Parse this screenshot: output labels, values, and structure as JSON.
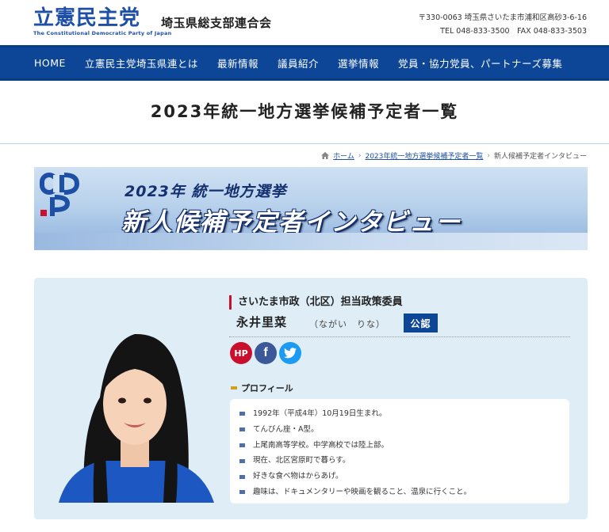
{
  "header": {
    "logo_main": "立憲民主党",
    "logo_sub": "The Constitutional Democratic Party of Japan",
    "branch": "埼玉県総支部連合会",
    "address_line1": "〒330-0063 埼玉県さいたま市浦和区高砂3-6-16",
    "address_line2": "TEL 048-833-3500　FAX 048-833-3503"
  },
  "nav": {
    "items": [
      {
        "label": "HOME"
      },
      {
        "label": "立憲民主党埼玉県連とは"
      },
      {
        "label": "最新情報"
      },
      {
        "label": "議員紹介"
      },
      {
        "label": "選挙情報"
      },
      {
        "label": "党員・協力党員、パートナーズ募集"
      }
    ]
  },
  "page_title": "2023年統一地方選挙候補予定者一覧",
  "breadcrumb": {
    "home": "ホーム",
    "parent": "2023年統一地方選挙候補予定者一覧",
    "current": "新人候補予定者インタビュー"
  },
  "banner": {
    "logo_text": "CDP",
    "line1": "2023年 統一地方選挙",
    "line2": "新人候補予定者インタビュー"
  },
  "profile": {
    "role": "さいたま市政（北区）担当政策委員",
    "name": "永井里菜",
    "kana": "（ながい　りな）",
    "badge": "公認",
    "sns": {
      "hp": "HP",
      "facebook": "f"
    },
    "heading": "プロフィール",
    "items": [
      "1992年（平成4年）10月19日生まれ。",
      "てんびん座・A型。",
      "上尾南高等学校。中学高校では陸上部。",
      "現在、北区宮原町で暮らす。",
      "好きな食べ物はからあげ。",
      "趣味は、ドキュメンタリーや映画を観ること、温泉に行くこと。"
    ]
  },
  "colors": {
    "brand_blue": "#0e4697",
    "accent_red": "#c8102e",
    "card_bg": "#dfeef6"
  }
}
